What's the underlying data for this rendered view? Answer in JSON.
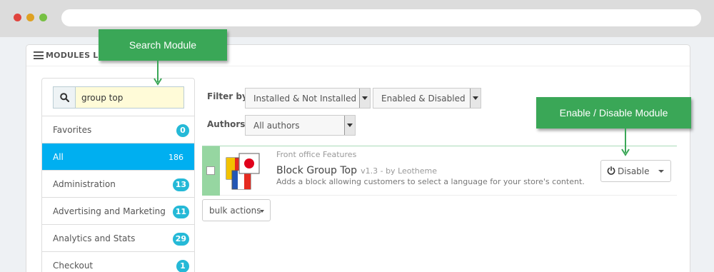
{
  "browser": {
    "url": ""
  },
  "panel": {
    "title": "MODULES LIST"
  },
  "search": {
    "value": "group top"
  },
  "categories": [
    {
      "label": "Favorites",
      "count": "0"
    },
    {
      "label": "All",
      "count": "186",
      "active": true
    },
    {
      "label": "Administration",
      "count": "13"
    },
    {
      "label": "Advertising and Marketing",
      "count": "11"
    },
    {
      "label": "Analytics and Stats",
      "count": "29"
    },
    {
      "label": "Checkout",
      "count": "1"
    }
  ],
  "filters": {
    "filter_by_label": "Filter by",
    "install_filter": "Installed & Not Installed",
    "enable_filter": "Enabled & Disabled",
    "authors_label": "Authors",
    "authors_filter": "All authors"
  },
  "module": {
    "category": "Front office Features",
    "name": "Block Group Top",
    "version": "v1.3 - by Leotheme",
    "description": "Adds a block allowing customers to select a language for your store's content.",
    "action_label": "Disable"
  },
  "bulk_actions_label": "bulk actions",
  "callouts": {
    "search": "Search Module",
    "enable": "Enable / Disable Module"
  },
  "icons": {
    "list": "list-icon",
    "search": "search-icon",
    "power": "power-icon",
    "logo": "module-logo-icon"
  },
  "colors": {
    "accent": "#00aff0",
    "badge": "#25b9d7",
    "callout": "#3aa757",
    "installed_strip": "#96d6a1"
  }
}
